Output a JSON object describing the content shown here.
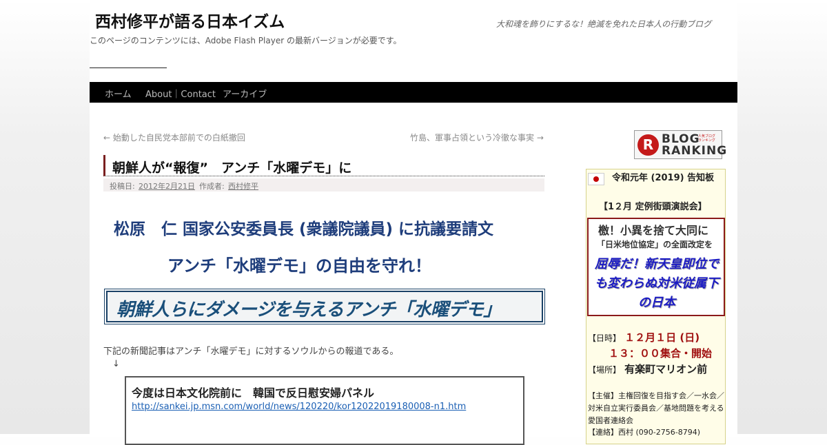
{
  "site": {
    "title": "西村修平が語る日本イズム",
    "description": "大和魂を飾りにするな！絶滅を免れた日本人の行動ブログ",
    "flash_note": "このページのコンテンツには、Adobe Flash Player の最新バージョンが必要です。"
  },
  "nav": {
    "items": [
      {
        "label": "ホーム"
      },
      {
        "label": "About｜Contact"
      },
      {
        "label": "アーカイブ"
      }
    ]
  },
  "post_nav": {
    "prev": "← 始動した自民党本部前での白紙撤回",
    "next": "竹島、軍事占領という冷徹な事実 →"
  },
  "post": {
    "title": "朝鮮人が“報復”　アンチ「水曜デモ」に",
    "meta": {
      "posted_label": "投稿日:",
      "date": "2012年2月21日",
      "author_label": "作成者:",
      "author": "西村修平"
    },
    "heading1": "松原　仁 国家公安委員長 (衆議院議員) に抗議要請文",
    "heading2": "アンチ「水曜デモ」の自由を守れ！",
    "banner": "朝鮮人らにダメージを与えるアンチ「水曜デモ」",
    "body": "下記の新聞記事はアンチ「水曜デモ」に対するソウルからの報道である。",
    "arrow": "↓",
    "quote": {
      "title": "今度は日本文化院前に　韓国で反日慰安婦パネル",
      "link": "http://sankei.jp.msn.com/world/news/120220/kor12022019180008-n1.htm"
    }
  },
  "sidebar": {
    "ranking": {
      "line1": "BLOG",
      "line2": "RANKING",
      "tag": "人気ブログランキング"
    },
    "notice_title": "令和元年 (2019) 告知板",
    "event": "【1２月 定例街頭演説会】",
    "slogan1": "檄！小異を捨て大同に",
    "slogan2": "「日米地位協定」の全面改定を",
    "slogan3": "屈辱だ！新天皇即位でも変わらぬ対米従属下の日本",
    "date_label": "【日時】",
    "date_value": "１２月１日 (日)",
    "time_value": "１３：００集合・開始",
    "place_label": "【場所】",
    "place_value": "有楽町マリオン前",
    "organizers": "【主催】主権回復を目指す会／一水会／対米自立実行委員会／基地問題を考える愛国者連絡会",
    "contact": "【連絡】西村 (090-2756-8794)"
  }
}
